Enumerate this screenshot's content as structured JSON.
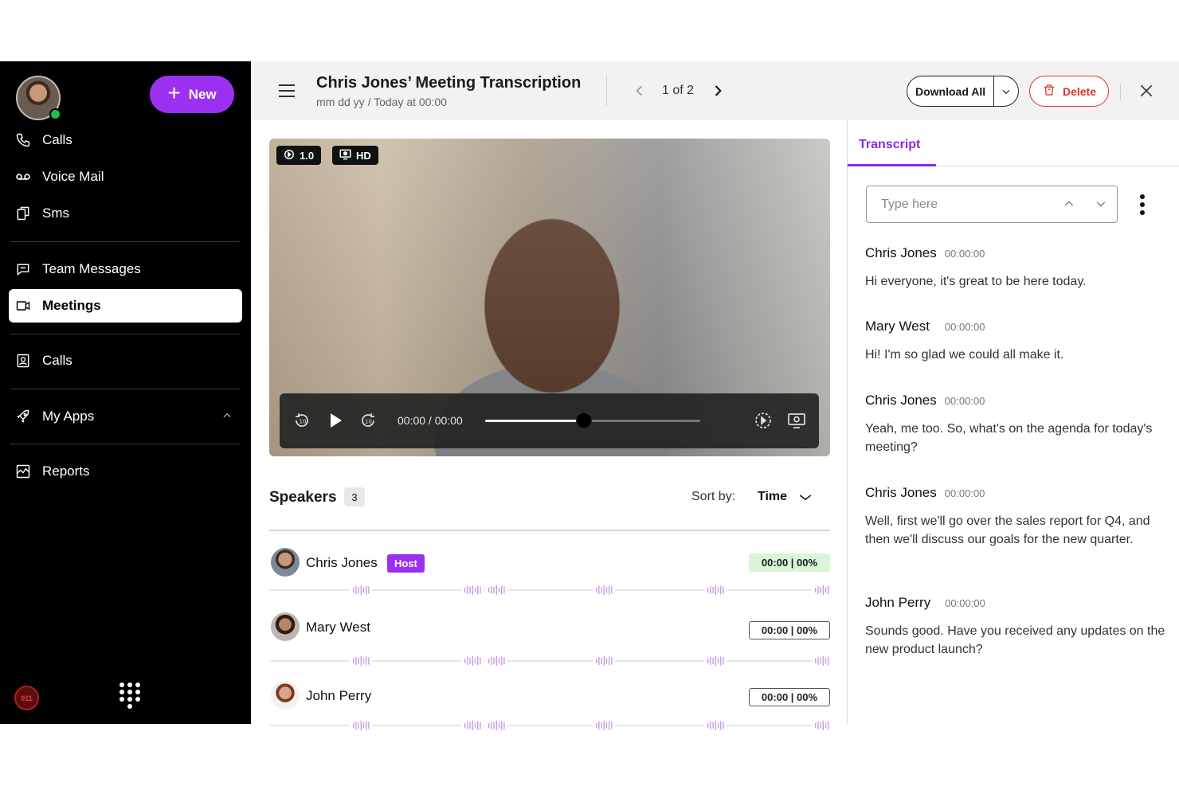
{
  "sidebar": {
    "new_label": "New",
    "items": [
      {
        "label": "Calls",
        "icon": "phone-icon"
      },
      {
        "label": "Voice Mail",
        "icon": "voicemail-icon"
      },
      {
        "label": "Sms",
        "icon": "sms-icon"
      },
      {
        "label": "Team Messages",
        "icon": "chat-icon"
      },
      {
        "label": "Meetings",
        "icon": "video-icon",
        "active": true
      },
      {
        "label": "Calls",
        "icon": "contact-card-icon"
      },
      {
        "label": "My Apps",
        "icon": "rocket-icon"
      },
      {
        "label": "Reports",
        "icon": "chart-icon"
      }
    ],
    "emergency_label": "911"
  },
  "header": {
    "title": "Chris Jones’ Meeting Transcription",
    "subtitle": "mm dd yy / Today at 00:00",
    "pager": "1 of 2",
    "download_label": "Download All",
    "delete_label": "Delete"
  },
  "video": {
    "speed_label": "1.0",
    "quality_label": "HD",
    "time_label": "00:00 / 00:00",
    "progress_fraction": 0.46
  },
  "speakers": {
    "title": "Speakers",
    "count": "3",
    "sort_label": "Sort by:",
    "sort_value": "Time",
    "list": [
      {
        "name": "Chris Jones",
        "badge": "Host",
        "stat": "00:00 | 00%",
        "highlight": true
      },
      {
        "name": "Mary West",
        "badge": "",
        "stat": "00:00 | 00%",
        "highlight": false
      },
      {
        "name": "John Perry",
        "badge": "",
        "stat": "00:00 | 00%",
        "highlight": false
      }
    ]
  },
  "transcript": {
    "tab_label": "Transcript",
    "search_placeholder": "Type here",
    "entries": [
      {
        "speaker": "Chris Jones",
        "time": "00:00:00",
        "text": "Hi everyone, it's great to be here today."
      },
      {
        "speaker": "Mary West",
        "time": "00:00:00",
        "text": "Hi! I'm so glad we could all make it."
      },
      {
        "speaker": "Chris Jones",
        "time": "00:00:00",
        "text": "Yeah, me too. So, what's on the agenda for today's meeting?"
      },
      {
        "speaker": "Chris Jones",
        "time": "00:00:00",
        "text": "Well, first we'll go over the sales report for Q4, and then we'll discuss our goals for the new quarter."
      },
      {
        "speaker": "John Perry",
        "time": "00:00:00",
        "text": "Sounds good. Have you received any updates on the new product launch?"
      }
    ]
  },
  "colors": {
    "accent": "#9b30f0",
    "danger": "#d9342b",
    "highlight": "#d8f5d8"
  }
}
